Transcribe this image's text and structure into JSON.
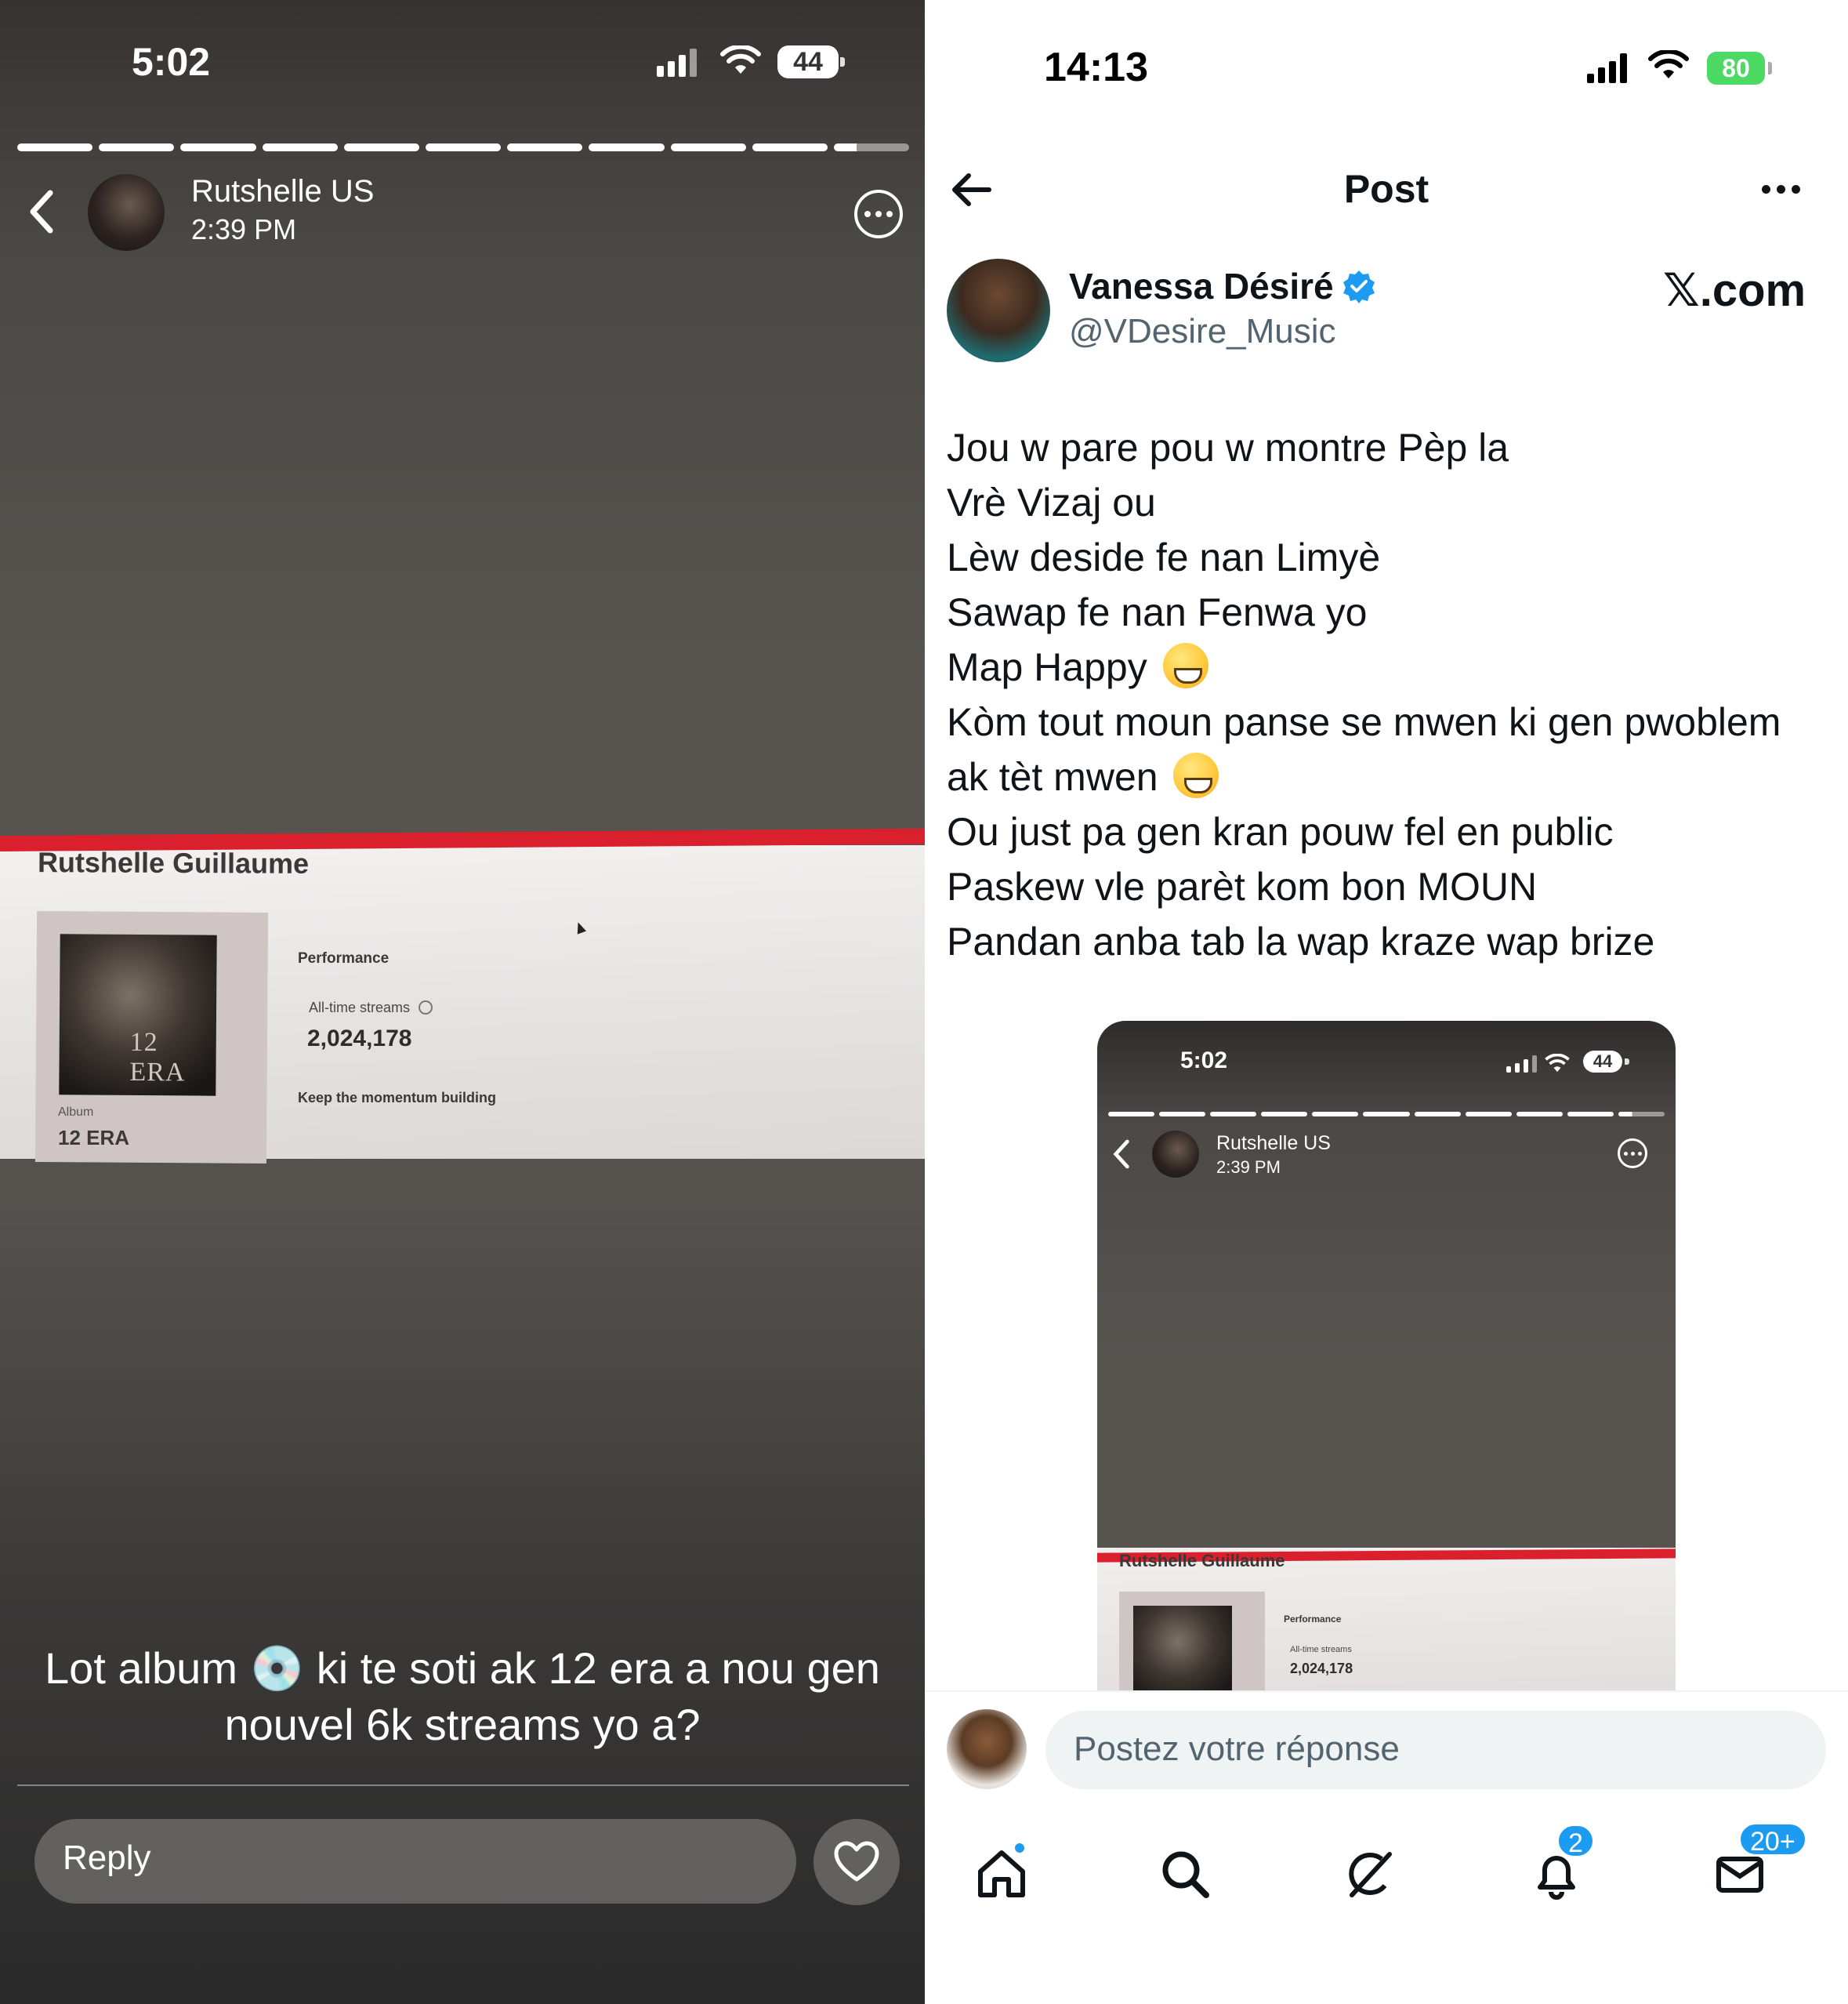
{
  "left_story": {
    "status_bar": {
      "time": "5:02",
      "battery": "44"
    },
    "header": {
      "account_name": "Rutshelle US",
      "post_time": "2:39 PM"
    },
    "progress_segments": 11,
    "photo": {
      "artist_name": "Rutshelle Guillaume",
      "album_cover_text": "12 ERA",
      "album_label": "Album",
      "album_name": "12 ERA",
      "performance_label": "Performance",
      "all_time_streams_label": "All-time streams",
      "all_time_streams_value": "2,024,178",
      "momentum_text": "Keep the momentum building"
    },
    "caption_line1": "Lot album 💿 ki te soti ak 12 era a nou gen",
    "caption_line2": "nouvel 6k streams yo a?",
    "reply_placeholder": "Reply"
  },
  "right_post": {
    "status_bar": {
      "time": "14:13",
      "battery": "80"
    },
    "nav": {
      "title": "Post"
    },
    "author": {
      "name": "Vanessa Désiré",
      "handle": "@VDesire_Music",
      "watermark": "𝕏.com"
    },
    "lines": [
      "Jou w pare pou w montre Pèp la",
      "Vrè Vizaj ou",
      "Lèw deside fe nan Limyè",
      "Sawap fe nan Fenwa yo",
      "Map Happy",
      "Kòm tout moun panse se mwen ki gen pwoblem",
      "ak tèt mwen",
      "Ou just pa gen kran pouw fel en public",
      "Paskew vle parèt kom bon MOUN",
      "Pandan anba tab la wap kraze wap brize"
    ],
    "embed": {
      "time": "5:02",
      "battery": "44",
      "account_name": "Rutshelle US",
      "post_time": "2:39 PM",
      "artist_name": "Rutshelle Guillaume",
      "performance_label": "Performance",
      "all_time_streams_label": "All-time streams",
      "all_time_streams_value": "2,024,178"
    },
    "reply_placeholder": "Postez votre réponse",
    "tabs": {
      "notifications_badge": "2",
      "messages_badge": "20+"
    }
  },
  "colors": {
    "accent": "#1d9bf0",
    "red_bar": "#d9202c",
    "battery_green": "#4cd964"
  }
}
